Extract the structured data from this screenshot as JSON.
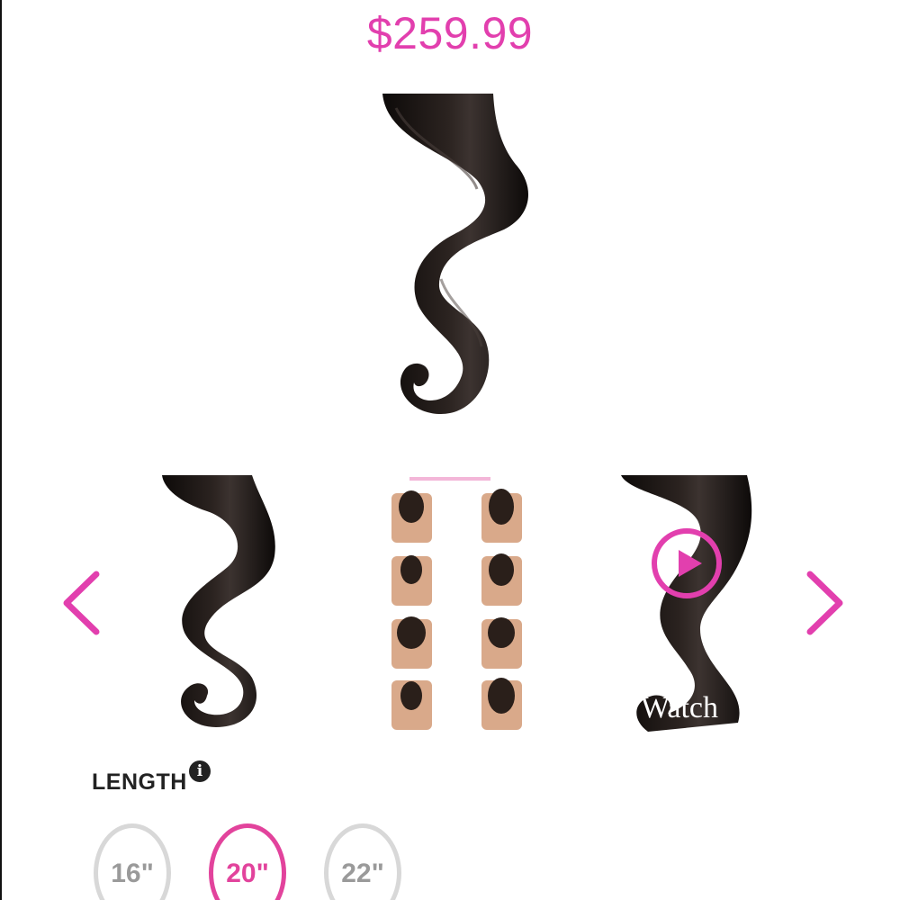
{
  "product": {
    "price": "$259.99"
  },
  "gallery": {
    "prev_icon": "chevron-left-icon",
    "next_icon": "chevron-right-icon",
    "thumbnails": [
      {
        "name": "hair-extension-wave-thumbnail"
      },
      {
        "name": "application-steps-thumbnail"
      },
      {
        "name": "video-thumbnail",
        "overlay_text": "Watch"
      }
    ],
    "play_icon": "play-icon"
  },
  "length": {
    "label": "LENGTH",
    "info_icon_glyph": "i",
    "options": [
      "16\"",
      "20\"",
      "22\""
    ],
    "selected": "20\""
  },
  "colors": {
    "accent": "#e23fae",
    "hair": "#1a1412",
    "option_border": "#d8d8d8",
    "option_text": "#9a9a9a"
  }
}
